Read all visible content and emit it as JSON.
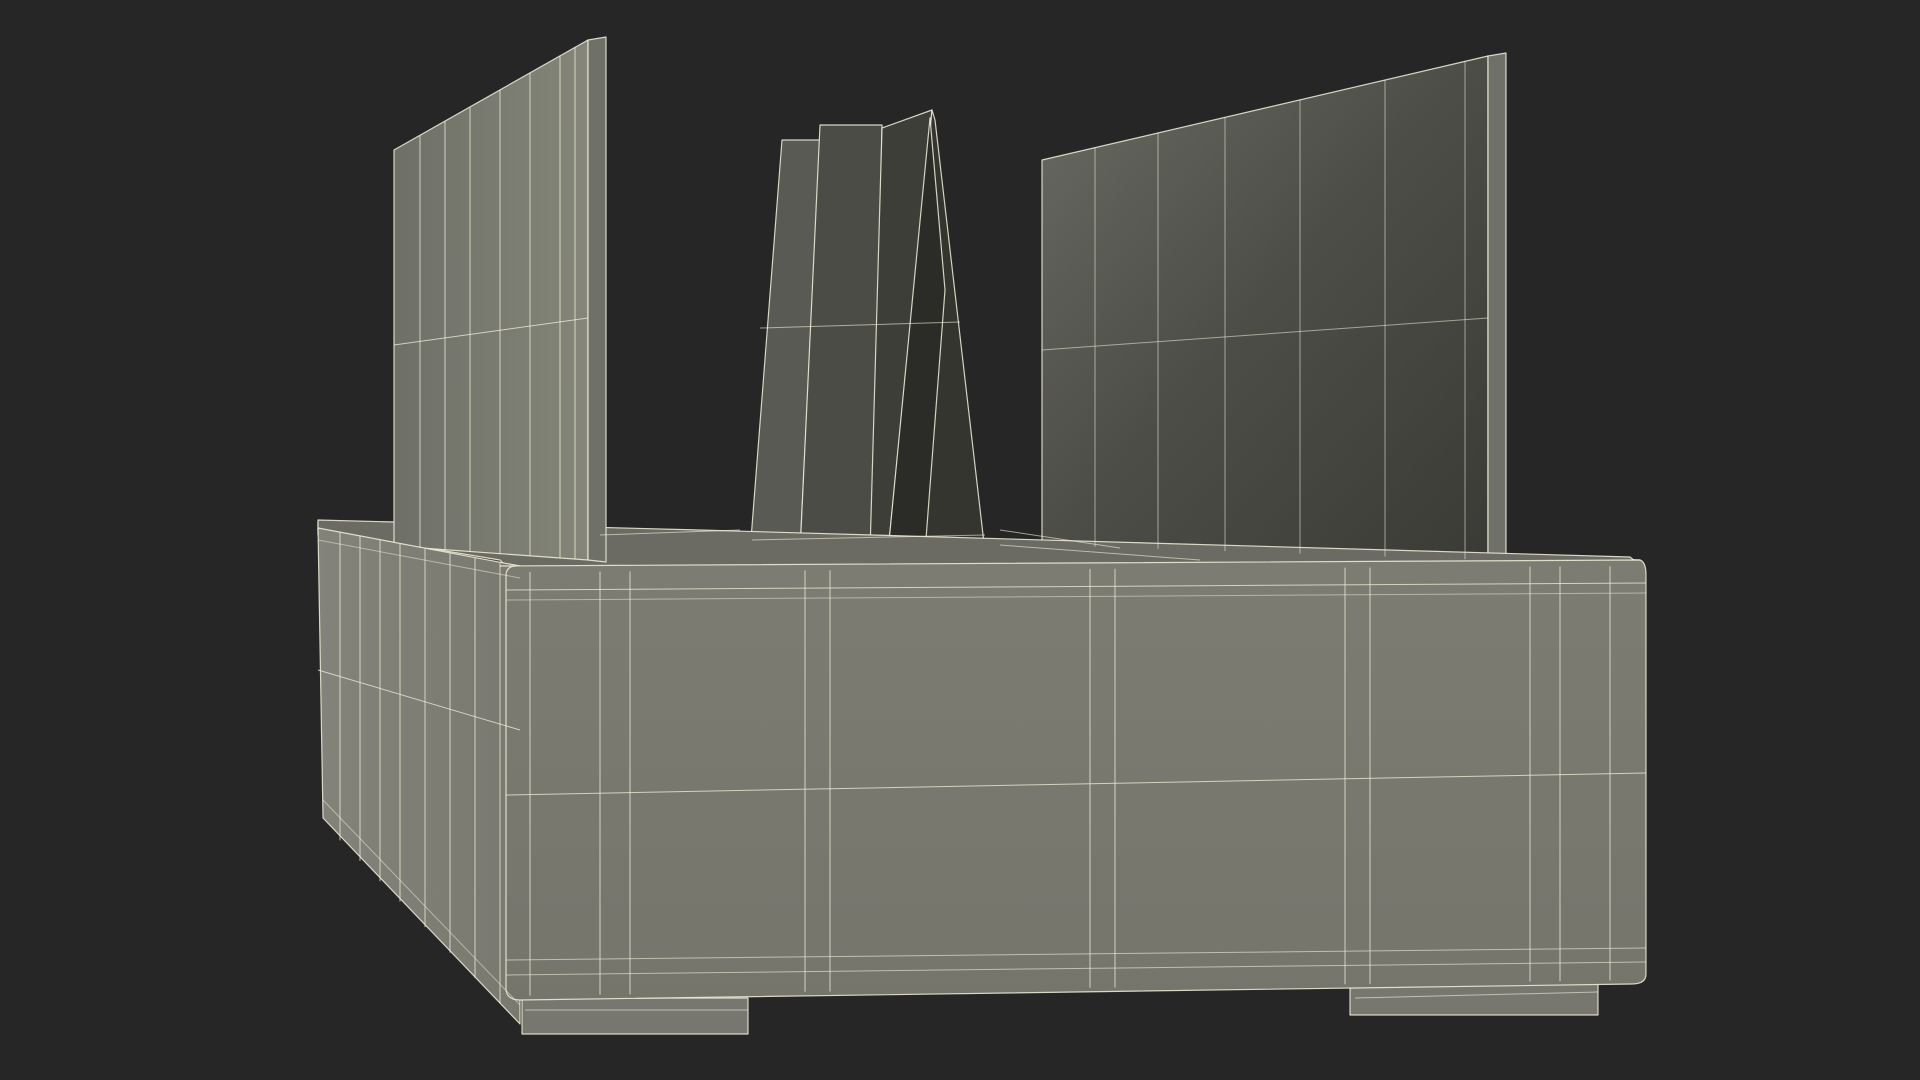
{
  "scene": {
    "background": "#262626",
    "wire_color": "#f2f0da",
    "base_side_color": "#7a7a70",
    "base_front_color": "#777770",
    "base_top_color": "#6b6b63",
    "base_inner_color": "#3a3b35",
    "panel_color": "#6f7068",
    "panel_dark_color": "#3e3f39",
    "frame_color": "#4a4a44",
    "objects": [
      "base-planter",
      "left-panel",
      "right-panel",
      "center-panel-stack",
      "left-foot",
      "right-foot"
    ]
  }
}
